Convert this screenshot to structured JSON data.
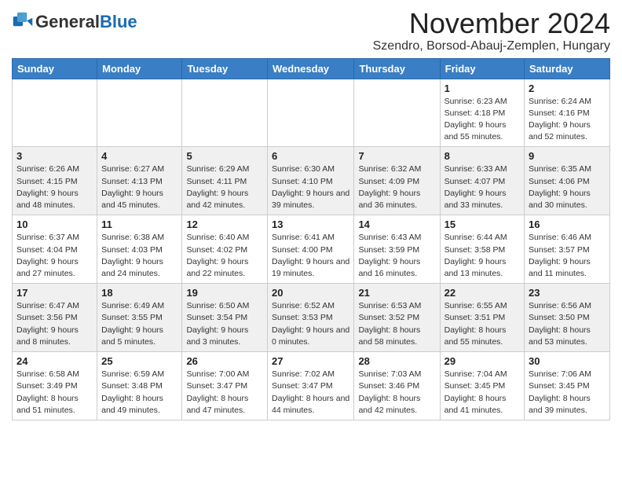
{
  "header": {
    "logo_general": "General",
    "logo_blue": "Blue",
    "month_year": "November 2024",
    "location": "Szendro, Borsod-Abauj-Zemplen, Hungary"
  },
  "weekdays": [
    "Sunday",
    "Monday",
    "Tuesday",
    "Wednesday",
    "Thursday",
    "Friday",
    "Saturday"
  ],
  "weeks": [
    [
      {
        "day": "",
        "info": ""
      },
      {
        "day": "",
        "info": ""
      },
      {
        "day": "",
        "info": ""
      },
      {
        "day": "",
        "info": ""
      },
      {
        "day": "",
        "info": ""
      },
      {
        "day": "1",
        "info": "Sunrise: 6:23 AM\nSunset: 4:18 PM\nDaylight: 9 hours and 55 minutes."
      },
      {
        "day": "2",
        "info": "Sunrise: 6:24 AM\nSunset: 4:16 PM\nDaylight: 9 hours and 52 minutes."
      }
    ],
    [
      {
        "day": "3",
        "info": "Sunrise: 6:26 AM\nSunset: 4:15 PM\nDaylight: 9 hours and 48 minutes."
      },
      {
        "day": "4",
        "info": "Sunrise: 6:27 AM\nSunset: 4:13 PM\nDaylight: 9 hours and 45 minutes."
      },
      {
        "day": "5",
        "info": "Sunrise: 6:29 AM\nSunset: 4:11 PM\nDaylight: 9 hours and 42 minutes."
      },
      {
        "day": "6",
        "info": "Sunrise: 6:30 AM\nSunset: 4:10 PM\nDaylight: 9 hours and 39 minutes."
      },
      {
        "day": "7",
        "info": "Sunrise: 6:32 AM\nSunset: 4:09 PM\nDaylight: 9 hours and 36 minutes."
      },
      {
        "day": "8",
        "info": "Sunrise: 6:33 AM\nSunset: 4:07 PM\nDaylight: 9 hours and 33 minutes."
      },
      {
        "day": "9",
        "info": "Sunrise: 6:35 AM\nSunset: 4:06 PM\nDaylight: 9 hours and 30 minutes."
      }
    ],
    [
      {
        "day": "10",
        "info": "Sunrise: 6:37 AM\nSunset: 4:04 PM\nDaylight: 9 hours and 27 minutes."
      },
      {
        "day": "11",
        "info": "Sunrise: 6:38 AM\nSunset: 4:03 PM\nDaylight: 9 hours and 24 minutes."
      },
      {
        "day": "12",
        "info": "Sunrise: 6:40 AM\nSunset: 4:02 PM\nDaylight: 9 hours and 22 minutes."
      },
      {
        "day": "13",
        "info": "Sunrise: 6:41 AM\nSunset: 4:00 PM\nDaylight: 9 hours and 19 minutes."
      },
      {
        "day": "14",
        "info": "Sunrise: 6:43 AM\nSunset: 3:59 PM\nDaylight: 9 hours and 16 minutes."
      },
      {
        "day": "15",
        "info": "Sunrise: 6:44 AM\nSunset: 3:58 PM\nDaylight: 9 hours and 13 minutes."
      },
      {
        "day": "16",
        "info": "Sunrise: 6:46 AM\nSunset: 3:57 PM\nDaylight: 9 hours and 11 minutes."
      }
    ],
    [
      {
        "day": "17",
        "info": "Sunrise: 6:47 AM\nSunset: 3:56 PM\nDaylight: 9 hours and 8 minutes."
      },
      {
        "day": "18",
        "info": "Sunrise: 6:49 AM\nSunset: 3:55 PM\nDaylight: 9 hours and 5 minutes."
      },
      {
        "day": "19",
        "info": "Sunrise: 6:50 AM\nSunset: 3:54 PM\nDaylight: 9 hours and 3 minutes."
      },
      {
        "day": "20",
        "info": "Sunrise: 6:52 AM\nSunset: 3:53 PM\nDaylight: 9 hours and 0 minutes."
      },
      {
        "day": "21",
        "info": "Sunrise: 6:53 AM\nSunset: 3:52 PM\nDaylight: 8 hours and 58 minutes."
      },
      {
        "day": "22",
        "info": "Sunrise: 6:55 AM\nSunset: 3:51 PM\nDaylight: 8 hours and 55 minutes."
      },
      {
        "day": "23",
        "info": "Sunrise: 6:56 AM\nSunset: 3:50 PM\nDaylight: 8 hours and 53 minutes."
      }
    ],
    [
      {
        "day": "24",
        "info": "Sunrise: 6:58 AM\nSunset: 3:49 PM\nDaylight: 8 hours and 51 minutes."
      },
      {
        "day": "25",
        "info": "Sunrise: 6:59 AM\nSunset: 3:48 PM\nDaylight: 8 hours and 49 minutes."
      },
      {
        "day": "26",
        "info": "Sunrise: 7:00 AM\nSunset: 3:47 PM\nDaylight: 8 hours and 47 minutes."
      },
      {
        "day": "27",
        "info": "Sunrise: 7:02 AM\nSunset: 3:47 PM\nDaylight: 8 hours and 44 minutes."
      },
      {
        "day": "28",
        "info": "Sunrise: 7:03 AM\nSunset: 3:46 PM\nDaylight: 8 hours and 42 minutes."
      },
      {
        "day": "29",
        "info": "Sunrise: 7:04 AM\nSunset: 3:45 PM\nDaylight: 8 hours and 41 minutes."
      },
      {
        "day": "30",
        "info": "Sunrise: 7:06 AM\nSunset: 3:45 PM\nDaylight: 8 hours and 39 minutes."
      }
    ]
  ]
}
